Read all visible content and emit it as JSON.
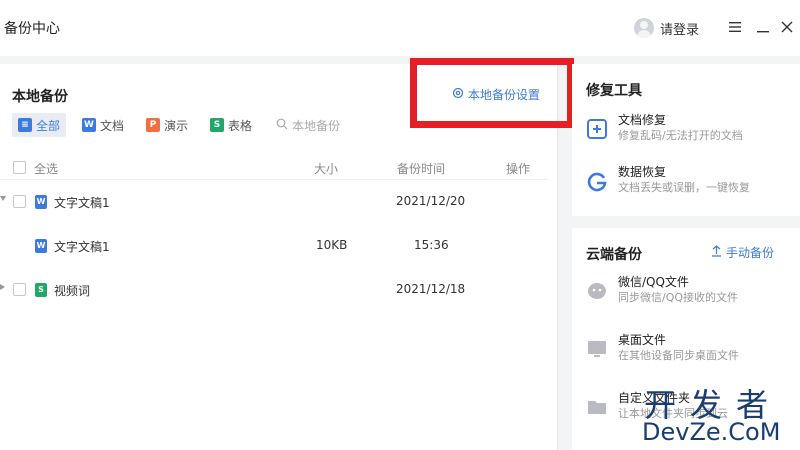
{
  "window": {
    "title": "备份中心",
    "login_label": "请登录",
    "menu_icon": "menu-icon",
    "minimize_icon": "minimize-icon",
    "close_icon": "close-icon"
  },
  "local_backup": {
    "title": "本地备份",
    "settings_label": "本地备份设置",
    "filters": [
      {
        "label": "全部",
        "icon": "all-icon",
        "color": "#3b7be0",
        "active": true
      },
      {
        "label": "文档",
        "icon": "writer-icon",
        "color": "#3b7be0",
        "active": false
      },
      {
        "label": "演示",
        "icon": "presentation-icon",
        "color": "#f26f3e",
        "active": false
      },
      {
        "label": "表格",
        "icon": "spreadsheet-icon",
        "color": "#1fa866",
        "active": false
      }
    ],
    "search_placeholder": "本地备份",
    "columns": {
      "select_all": "全选",
      "size": "大小",
      "time": "备份时间",
      "actions": "操作"
    },
    "rows": [
      {
        "name": "文字文稿1",
        "size": "",
        "time": "2021/12/20",
        "type": "writer",
        "expanded": true
      },
      {
        "name": "文字文稿1",
        "size": "10KB",
        "time": "15:36",
        "type": "writer",
        "child": true
      },
      {
        "name": "视频词",
        "size": "",
        "time": "2021/12/18",
        "type": "spreadsheet",
        "expanded": false
      }
    ]
  },
  "repair_tools": {
    "title": "修复工具",
    "items": [
      {
        "name": "文档修复",
        "desc": "修复乱码/无法打开的文档",
        "icon": "document-repair-icon"
      },
      {
        "name": "数据恢复",
        "desc": "文档丢失或误删，一键恢复",
        "icon": "data-recovery-icon"
      }
    ]
  },
  "cloud_backup": {
    "title": "云端备份",
    "manual_label": "手动备份",
    "items": [
      {
        "name": "微信/QQ文件",
        "desc": "同步微信/QQ接收的文件",
        "icon": "chat-icon"
      },
      {
        "name": "桌面文件",
        "desc": "在其他设备同步桌面文件",
        "icon": "desktop-icon"
      },
      {
        "name": "自定义文件夹",
        "desc": "让本地文件夹同步到云",
        "icon": "folder-icon"
      }
    ]
  },
  "watermark": {
    "top": "开发者",
    "bottom": "DevZe.CoM"
  },
  "colors": {
    "accent": "#3d7ad6",
    "highlight_box": "#e81e25",
    "background": "#f3f4f6"
  }
}
